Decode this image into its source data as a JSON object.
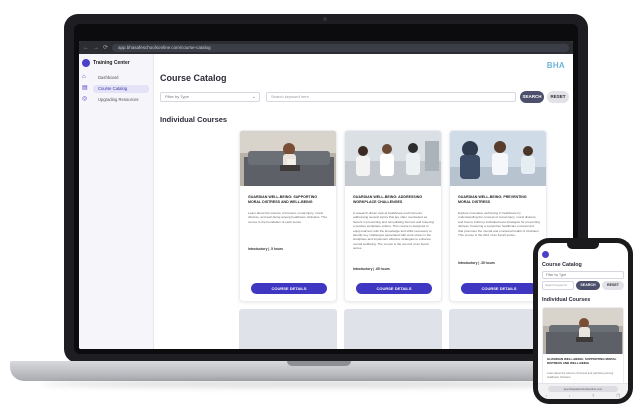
{
  "browser": {
    "back": "←",
    "forward": "→",
    "reload": "⟳",
    "url": "app.bhasafeschoolsonline.com/course-catalog"
  },
  "sidebar": {
    "title": "Training Center",
    "items": [
      {
        "label": "Dashboard",
        "active": false
      },
      {
        "label": "Course Catalog",
        "active": true
      },
      {
        "label": "Upgrading Resources",
        "active": false
      }
    ]
  },
  "brand": "BHA",
  "main": {
    "title": "Course Catalog",
    "filter_placeholder": "Filter by Type",
    "search_placeholder": "Search keyword here",
    "search_label": "SEARCH",
    "reset_label": "RESET",
    "section_title": "Individual Courses"
  },
  "courses": [
    {
      "title": "Guardian Well-Being: Supporting Moral Distress and Well-Being",
      "description": "Learn about the science of burnout, moral injury, moral distress, and well-being among healthcare clinicians. This course is the foundation of each series.",
      "meta": "Introductory  |  .5 hours",
      "button": "COURSE DETAILS"
    },
    {
      "title": "Guardian Well-Being: Addressing Workplace Challenges",
      "description": "A research-driven look at healthcare environments, addressing several topics that are often overlooked as factors in preventing and remediating burnout and fostering a positive workplace culture. This course is designed to equip learners with the knowledge and skills necessary to identify key challenges associated with work stress in the workplace and implement effective strategies to enhance overall wellbeing. The course is the second of an 8-part series.",
      "meta": "Introductory  |  .65 hours",
      "button": "COURSE DETAILS"
    },
    {
      "title": "Guardian Well-Being: Preventing Moral Distress",
      "description": "Explore innovative well-being in healthcare by understanding the concept of moral injury, moral distress, and how to build up individual level strategies for preventing distress. Fostering a supportive healthcare environment that promotes the mental and emotional health of clinicians. This course is the third of an 8-part series.",
      "meta": "Introductory  |  .35 hours",
      "button": "COURSE DETAILS"
    }
  ],
  "phone": {
    "title": "Course Catalog",
    "filter_placeholder": "Filter by Type",
    "search_placeholder": "Search keyword",
    "search_label": "SEARCH",
    "reset_label": "RESET",
    "section_title": "Individual Courses",
    "card_title": "Guardian Well-Being: Supporting Moral Distress and Well-Being",
    "card_text": "Learn about the science of burnout and well-being among healthcare clinicians.",
    "url": "app.bhasafeschoolsonline.com",
    "nav_back": "‹",
    "nav_forward": "›",
    "nav_share": "⇪",
    "nav_tabs": "❐"
  },
  "colors": {
    "accent": "#3f36c2",
    "brand": "#6fb3d9",
    "search_button": "#4c4f6b"
  }
}
